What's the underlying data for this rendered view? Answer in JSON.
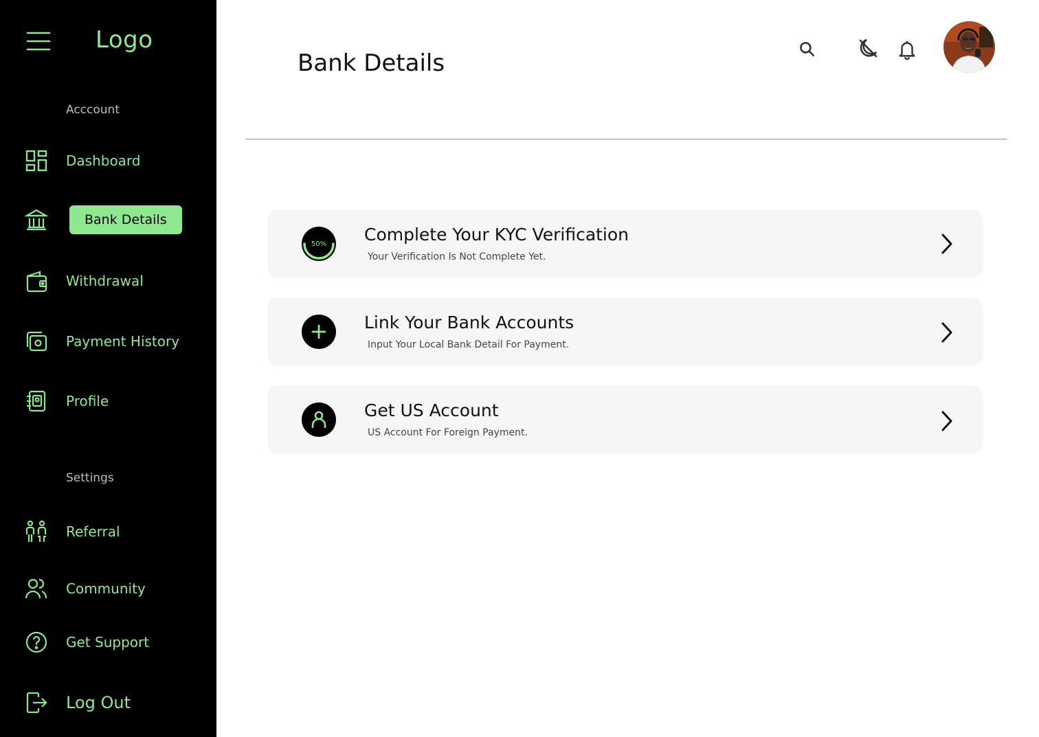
{
  "sidebar": {
    "logo": "Logo",
    "sections": {
      "account": "Acccount",
      "settings": "Settings"
    },
    "items": [
      {
        "label": "Dashboard",
        "icon": "dashboard-icon"
      },
      {
        "label": "Bank Details",
        "icon": "bank-icon",
        "active": true
      },
      {
        "label": "Withdrawal",
        "icon": "wallet-icon"
      },
      {
        "label": "Payment History",
        "icon": "payment-history-icon"
      },
      {
        "label": "Profile",
        "icon": "profile-book-icon"
      },
      {
        "label": "Referral",
        "icon": "referral-icon"
      },
      {
        "label": "Community",
        "icon": "community-icon"
      },
      {
        "label": "Get Support",
        "icon": "help-icon"
      },
      {
        "label": "Log Out",
        "icon": "logout-icon"
      }
    ]
  },
  "header": {
    "title": "Bank Details",
    "icons": [
      "search-icon",
      "dark-mode-icon",
      "notification-bell-icon",
      "user-avatar"
    ]
  },
  "cards": [
    {
      "title": "Complete Your KYC Verification",
      "subtitle": "Your Verification Is Not Complete Yet.",
      "progress_label": "50%",
      "progress": 0.5
    },
    {
      "title": "Link Your Bank Accounts",
      "subtitle": "Input Your Local Bank Detail For Payment."
    },
    {
      "title": "Get US Account",
      "subtitle": "US Account For Foreign Payment."
    }
  ],
  "colors": {
    "accent": "#8fe88f",
    "sidebar_bg": "#000000",
    "card_bg": "#f6f6f6"
  }
}
